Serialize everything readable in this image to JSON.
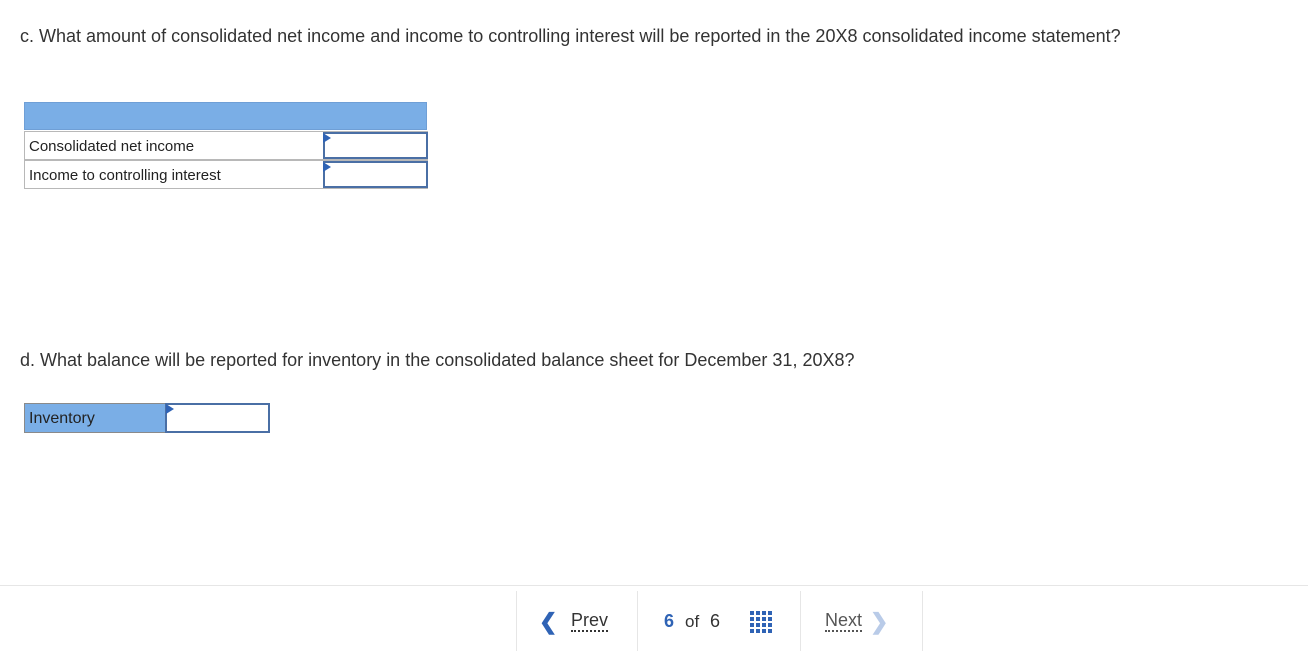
{
  "question_c": "c. What amount of consolidated net income and income to controlling interest will be reported in the 20X8 consolidated income statement?",
  "table_c": {
    "rows": [
      {
        "label": "Consolidated net income",
        "value": ""
      },
      {
        "label": "Income to controlling interest",
        "value": ""
      }
    ]
  },
  "question_d": "d. What balance will be reported for inventory in the consolidated balance sheet for December 31, 20X8?",
  "table_d": {
    "label": "Inventory",
    "value": ""
  },
  "footer": {
    "prev_label": "Prev",
    "next_label": "Next",
    "current_page": "6",
    "of_label": "of",
    "total_pages": "6",
    "prev_icon": "chevron-left-icon",
    "next_icon": "chevron-right-icon",
    "grid_icon": "grid-icon"
  },
  "colors": {
    "header_band": "#7aaee6",
    "accent": "#2f63b5",
    "input_border": "#4a6fa5"
  }
}
